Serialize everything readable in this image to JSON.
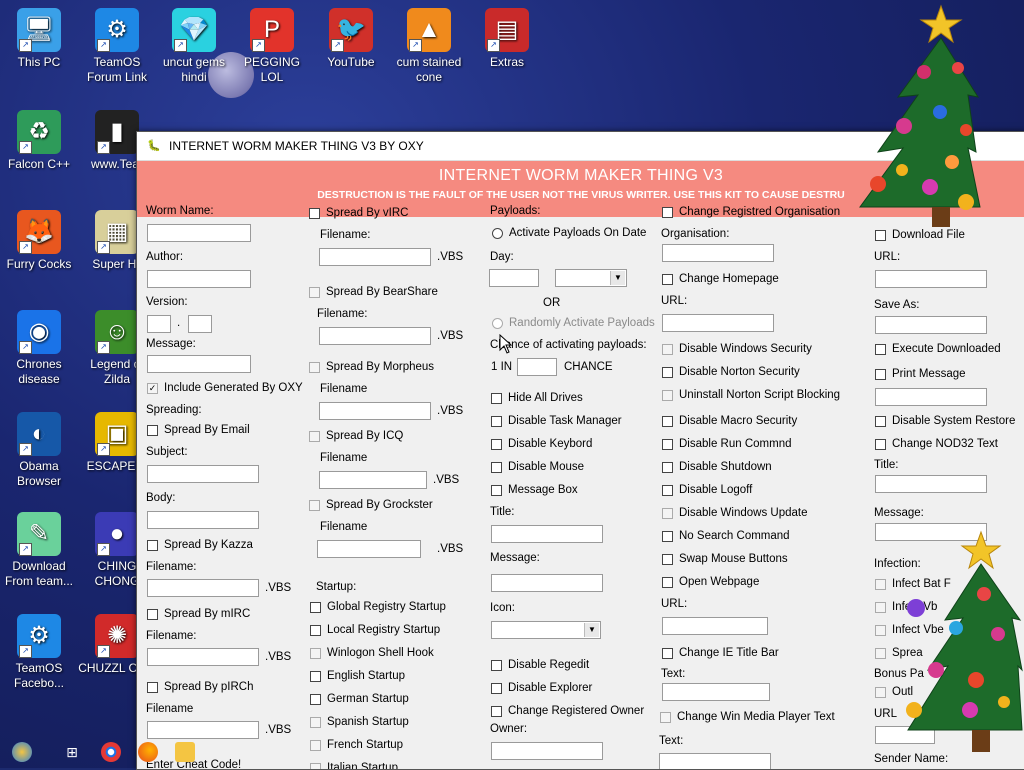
{
  "desktop": {
    "icons": [
      {
        "id": "this-pc",
        "label": "This PC",
        "color": "#3aa0e8",
        "glyph": "🖥"
      },
      {
        "id": "teamos-forum",
        "label": "TeamOS Forum Link",
        "color": "#1e88e5",
        "glyph": "⚙"
      },
      {
        "id": "uncut-gems",
        "label": "uncut gems hindi",
        "color": "#2ad1e0",
        "glyph": "💎"
      },
      {
        "id": "pegging-lol",
        "label": "PEGGING LOL",
        "color": "#e2332b",
        "glyph": "P"
      },
      {
        "id": "youtube",
        "label": "YouTube",
        "color": "#d0302a",
        "glyph": "🐦"
      },
      {
        "id": "cum-stained-cone",
        "label": "cum stained cone",
        "color": "#f08a1c",
        "glyph": "▲"
      },
      {
        "id": "extras",
        "label": "Extras",
        "color": "#c92a2a",
        "glyph": "▤"
      },
      {
        "id": "falcon-cpp",
        "label": "Falcon C++",
        "color": "#2e9b5a",
        "glyph": "♻"
      },
      {
        "id": "www-tear",
        "label": "www.Tear",
        "color": "#222",
        "glyph": "▮"
      },
      {
        "id": "furry-cocks",
        "label": "Furry Cocks",
        "color": "#e8571f",
        "glyph": "🦊"
      },
      {
        "id": "super-hil",
        "label": "Super Hil",
        "color": "#d8cf9a",
        "glyph": "▦"
      },
      {
        "id": "chrones-disease",
        "label": "Chrones disease",
        "color": "#1a73e8",
        "glyph": "◉"
      },
      {
        "id": "legend-zilda",
        "label": "Legend of Zilda",
        "color": "#3c8d2a",
        "glyph": "☺"
      },
      {
        "id": "obama-browser",
        "label": "Obama Browser",
        "color": "#1658a8",
        "glyph": "◐"
      },
      {
        "id": "escape",
        "label": "ESCAPE C",
        "color": "#e6b800",
        "glyph": "▣"
      },
      {
        "id": "download-team",
        "label": "Download From team...",
        "color": "#6ad19b",
        "glyph": "✎"
      },
      {
        "id": "ching-chong",
        "label": "CHING CHONG",
        "color": "#3b3bb5",
        "glyph": "●"
      },
      {
        "id": "teamos-facebook",
        "label": "TeamOS Facebo...",
        "color": "#1e88e5",
        "glyph": "⚙"
      },
      {
        "id": "chuzzle",
        "label": "CHUZZL CUM",
        "color": "#d12a2a",
        "glyph": "✺"
      }
    ]
  },
  "window": {
    "title": "INTERNET WORM MAKER THING V3  BY OXY",
    "banner_title": "INTERNET WORM MAKER THING V3",
    "banner_sub": "DESTRUCTION IS THE FAULT OF THE USER NOT THE VIRUS WRITER. USE THIS KIT TO CAUSE DESTRU",
    "col1": {
      "worm_name": "Worm Name:",
      "author": "Author:",
      "version": "Version:",
      "version_dot": ".",
      "message": "Message:",
      "include_generated": "Include Generated By OXY",
      "spreading": "Spreading:",
      "spread_email": "Spread By Email",
      "subject": "Subject:",
      "body": "Body:",
      "spread_kazza": "Spread By Kazza",
      "filename1": "Filename:",
      "vbs1": ".VBS",
      "spread_mirc": "Spread By mIRC",
      "filename2": "Filename:",
      "vbs2": ".VBS",
      "spread_pirch": "Spread By pIRCh",
      "filename3": "Filename",
      "vbs3": ".VBS",
      "enter_cheat": "Enter Cheat Code!"
    },
    "col2": {
      "spread_virc": "Spread By vIRC",
      "filename1": "Filename:",
      "vbs1": ".VBS",
      "spread_bearshare": "Spread By BearShare",
      "filename2": "Filename:",
      "vbs2": ".VBS",
      "spread_morpheus": "Spread By Morpheus",
      "filename3": "Filename",
      "vbs3": ".VBS",
      "spread_icq": "Spread By ICQ",
      "filename4": "Filename",
      "vbs4": ".VBS",
      "spread_grockster": "Spread By Grockster",
      "filename5": "Filename",
      "vbs5": ".VBS",
      "startup": "Startup:",
      "global_registry": "Global Registry Startup",
      "local_registry": "Local Registry Startup",
      "winlogon": "Winlogon Shell Hook",
      "english": "English Startup",
      "german": "German Startup",
      "spanish": "Spanish Startup",
      "french": "French Startup",
      "italian": "Italian Startup"
    },
    "col3": {
      "payloads": "Payloads:",
      "activate_on_date": "Activate Payloads On Date",
      "day": "Day:",
      "or": "OR",
      "randomly_activate": "Randomly Activate Payloads",
      "chance_of": "Chance of activating payloads:",
      "one_in": "1 IN",
      "chance": "CHANCE",
      "hide_drives": "Hide All Drives",
      "disable_task_manager": "Disable Task Manager",
      "disable_keybord": "Disable Keybord",
      "disable_mouse": "Disable Mouse",
      "message_box": "Message Box",
      "title": "Title:",
      "message": "Message:",
      "icon": "Icon:",
      "disable_regedit": "Disable Regedit",
      "disable_explorer": "Disable Explorer",
      "change_owner": "Change Registered Owner",
      "owner": "Owner:"
    },
    "col4": {
      "change_org": "Change Registred Organisation",
      "organisation": "Organisation:",
      "change_homepage": "Change Homepage",
      "url1": "URL:",
      "disable_win_security": "Disable Windows Security",
      "disable_norton": "Disable Norton Security",
      "uninstall_norton": "Uninstall Norton Script Blocking",
      "disable_macro": "Disable Macro Security",
      "disable_run": "Disable Run Commnd",
      "disable_shutdown": "Disable Shutdown",
      "disable_logoff": "Disable Logoff",
      "disable_win_update": "Disable Windows Update",
      "no_search": "No Search Command",
      "swap_mouse": "Swap Mouse Buttons",
      "open_webpage": "Open Webpage",
      "url2": "URL:",
      "change_ie_title": "Change IE Title Bar",
      "text1": "Text:",
      "change_wmp_text": "Change Win Media Player Text",
      "text2": "Text:"
    },
    "col5": {
      "download_file": "Download File",
      "url": "URL:",
      "save_as": "Save As:",
      "execute_downloaded": "Execute Downloaded",
      "print_message": "Print Message",
      "disable_system_restore": "Disable System Restore",
      "change_nod32": "Change NOD32 Text",
      "title": "Title:",
      "message": "Message:",
      "infection": "Infection:",
      "infect_bat": "Infect Bat F",
      "infect_vb": "Infect Vb",
      "infect_vbe": "Infect Vbe",
      "spread": "Sprea",
      "bonus": "Bonus Pa",
      "outlook": "Outl",
      "url2": "URL",
      "sender_name": "Sender Name:"
    }
  },
  "colors": {
    "banner": "#f58a80",
    "window_bg": "#f0f0f0",
    "desktop": "#1a2670"
  }
}
